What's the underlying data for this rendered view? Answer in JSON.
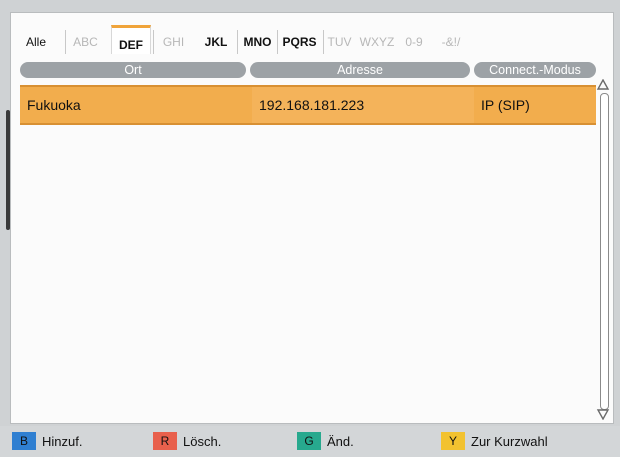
{
  "tabs": [
    {
      "label": "Alle",
      "state": "normal"
    },
    {
      "label": "ABC",
      "state": "dim"
    },
    {
      "label": "DEF",
      "state": "selected"
    },
    {
      "label": "GHI",
      "state": "dim"
    },
    {
      "label": "JKL",
      "state": "bold"
    },
    {
      "label": "MNO",
      "state": "bold"
    },
    {
      "label": "PQRS",
      "state": "bold"
    },
    {
      "label": "TUV",
      "state": "dim"
    },
    {
      "label": "WXYZ",
      "state": "dim"
    },
    {
      "label": "0-9",
      "state": "dim"
    },
    {
      "label": "-&!/",
      "state": "dim"
    }
  ],
  "columns": {
    "ort": "Ort",
    "adresse": "Adresse",
    "modus": "Connect.-Modus"
  },
  "rows": [
    {
      "ort": "Fukuoka",
      "adresse": "192.168.181.223",
      "modus": "IP (SIP)"
    }
  ],
  "footer": {
    "blue": {
      "key": "B",
      "label": "Hinzuf.",
      "color": "#2f7fd1"
    },
    "red": {
      "key": "R",
      "label": "Lösch.",
      "color": "#e8604c"
    },
    "green": {
      "key": "G",
      "label": "Änd.",
      "color": "#27a98e"
    },
    "yellow": {
      "key": "Y",
      "label": "Zur Kurzwahl",
      "color": "#f2c230"
    }
  },
  "colors": {
    "highlight": "#f2ad4d",
    "tab_accent": "#f0a43a",
    "header_bg": "#9da2a6"
  }
}
